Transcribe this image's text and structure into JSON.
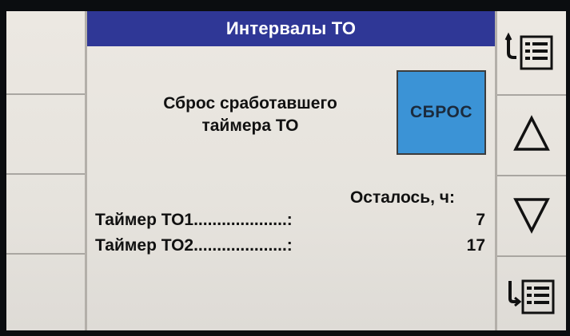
{
  "header": {
    "title": "Интервалы ТО"
  },
  "reset": {
    "label_line1": "Сброс сработавшего",
    "label_line2": "таймера ТО",
    "button_label": "СБРОС",
    "button_color": "#3b93d6"
  },
  "remaining": {
    "label": "Осталось, ч:"
  },
  "timers": [
    {
      "name": "Таймер ТО1....................:",
      "value": "7"
    },
    {
      "name": "Таймер ТО2....................:",
      "value": "17"
    }
  ],
  "nav": {
    "items": [
      {
        "icon": "list-first-icon"
      },
      {
        "icon": "arrow-up-icon"
      },
      {
        "icon": "arrow-down-icon"
      },
      {
        "icon": "list-last-icon"
      }
    ]
  },
  "colors": {
    "title_bar": "#2f3796"
  }
}
